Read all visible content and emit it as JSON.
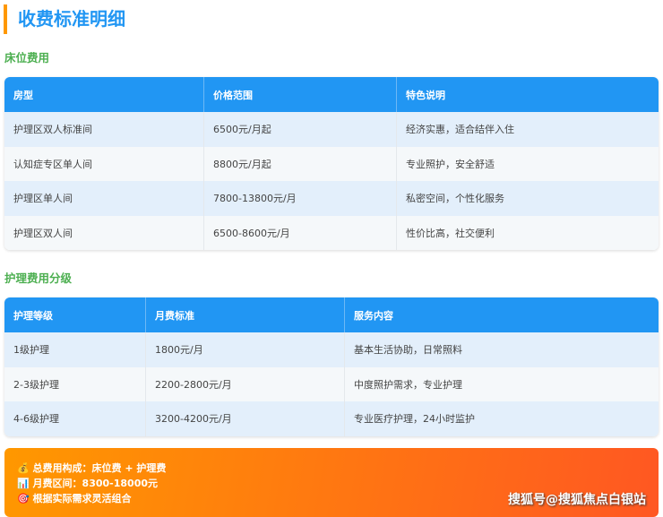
{
  "title": "收费标准明细",
  "bed": {
    "heading": "床位费用",
    "headers": [
      "房型",
      "价格范围",
      "特色说明"
    ],
    "rows": [
      [
        "护理区双人标准间",
        "6500元/月起",
        "经济实惠，适合结伴入住"
      ],
      [
        "认知症专区单人间",
        "8800元/月起",
        "专业照护，安全舒适"
      ],
      [
        "护理区单人间",
        "7800-13800元/月",
        "私密空间，个性化服务"
      ],
      [
        "护理区双人间",
        "6500-8600元/月",
        "性价比高，社交便利"
      ]
    ]
  },
  "care": {
    "heading": "护理费用分级",
    "headers": [
      "护理等级",
      "月费标准",
      "服务内容"
    ],
    "rows": [
      [
        "1级护理",
        "1800元/月",
        "基本生活协助，日常照料"
      ],
      [
        "2-3级护理",
        "2200-2800元/月",
        "中度照护需求，专业护理"
      ],
      [
        "4-6级护理",
        "3200-4200元/月",
        "专业医疗护理，24小时监护"
      ]
    ]
  },
  "footer": {
    "lines": [
      {
        "icon": "💰",
        "text": "总费用构成：床位费 + 护理费"
      },
      {
        "icon": "📊",
        "text": "月费区间：8300-18000元"
      },
      {
        "icon": "🎯",
        "text": "根据实际需求灵活组合"
      }
    ],
    "watermark": "搜狐号@搜狐焦点白银站"
  }
}
